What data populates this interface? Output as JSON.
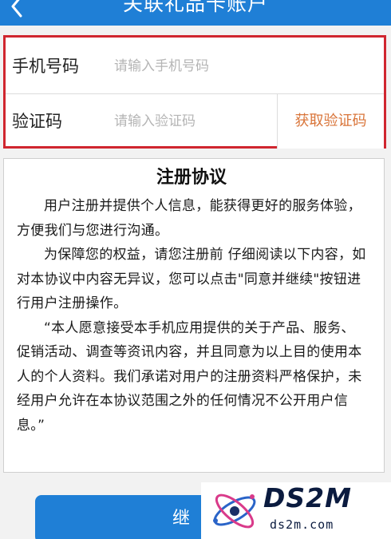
{
  "header": {
    "title": "关联礼品卡账户"
  },
  "form": {
    "phone": {
      "label": "手机号码",
      "placeholder": "请输入手机号码",
      "value": ""
    },
    "code": {
      "label": "验证码",
      "placeholder": "请输入验证码",
      "value": "",
      "get_code_label": "获取验证码"
    },
    "highlight_color": "#d0262f"
  },
  "agreement": {
    "title": "注册协议",
    "paragraphs": [
      "用户注册并提供个人信息，能获得更好的服务体验，方便我们与您进行沟通。",
      "为保障您的权益，请您注册前 仔细阅读以下内容，如对本协议中内容无异议，您可以点击\"同意并继续\"按钮进行用户注册操作。",
      "“本人愿意接受本手机应用提供的关于产品、服务、促销活动、调查等资讯内容，并且同意为以上目的使用本 人的个人资料。我们承诺对用户的注册资料严格保护，未经用户允许在本协议范围之外的任何情况不公开用户信息。”"
    ]
  },
  "footer": {
    "continue_label": "继"
  },
  "watermark": {
    "brand": "DS2M",
    "domain": "ds2m.com"
  },
  "colors": {
    "primary": "#1f7fd6",
    "accent_orange": "#d9753a",
    "highlight_red": "#d0262f"
  }
}
